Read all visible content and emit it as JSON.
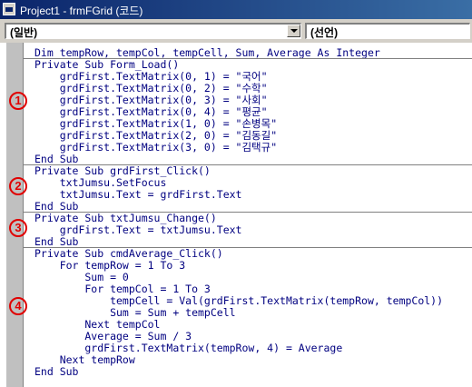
{
  "window": {
    "title": "Project1 - frmFGrid (코드)"
  },
  "combos": {
    "object_value": "(일반)",
    "procedure_value": "(선언)"
  },
  "markers": [
    "1",
    "2",
    "3",
    "4"
  ],
  "code_lines": [
    "Dim tempRow, tempCol, tempCell, Sum, Average As Integer",
    "Private Sub Form_Load()",
    "    grdFirst.TextMatrix(0, 1) = \"국어\"",
    "    grdFirst.TextMatrix(0, 2) = \"수학\"",
    "    grdFirst.TextMatrix(0, 3) = \"사회\"",
    "    grdFirst.TextMatrix(0, 4) = \"평균\"",
    "    grdFirst.TextMatrix(1, 0) = \"손병목\"",
    "    grdFirst.TextMatrix(2, 0) = \"김동길\"",
    "    grdFirst.TextMatrix(3, 0) = \"김택규\"",
    "End Sub",
    "Private Sub grdFirst_Click()",
    "    txtJumsu.SetFocus",
    "    txtJumsu.Text = grdFirst.Text",
    "End Sub",
    "Private Sub txtJumsu_Change()",
    "    grdFirst.Text = txtJumsu.Text",
    "End Sub",
    "Private Sub cmdAverage_Click()",
    "    For tempRow = 1 To 3",
    "        Sum = 0",
    "        For tempCol = 1 To 3",
    "            tempCell = Val(grdFirst.TextMatrix(tempRow, tempCol))",
    "            Sum = Sum + tempCell",
    "        Next tempCol",
    "        Average = Sum / 3",
    "        grdFirst.TextMatrix(tempRow, 4) = Average",
    "    Next tempRow",
    "End Sub"
  ]
}
